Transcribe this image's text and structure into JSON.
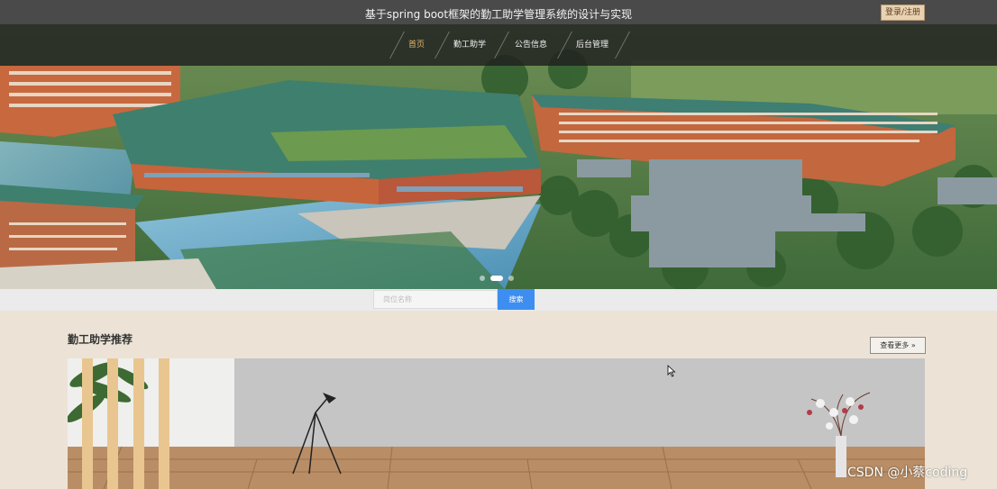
{
  "header": {
    "title": "基于spring boot框架的勤工助学管理系统的设计与实现",
    "login_label": "登录/注册"
  },
  "nav": {
    "items": [
      {
        "label": "首页",
        "active": true
      },
      {
        "label": "勤工助学",
        "active": false
      },
      {
        "label": "公告信息",
        "active": false
      },
      {
        "label": "后台管理",
        "active": false
      }
    ]
  },
  "carousel": {
    "slide_count": 3,
    "active_index": 1
  },
  "search": {
    "placeholder": "岗位名称",
    "button_label": "搜索",
    "accent": "#3d8ef0"
  },
  "section": {
    "title": "勤工助学推荐",
    "more_label": "查看更多 »"
  },
  "watermark": "CSDN @小蔡coding"
}
